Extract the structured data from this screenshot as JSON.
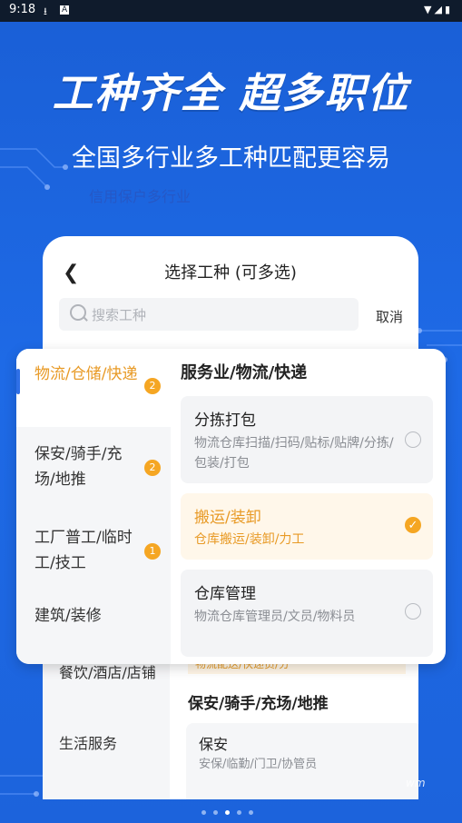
{
  "status": {
    "time": "9:18",
    "icons": [
      "download-icon",
      "app-icon"
    ],
    "right": [
      "wifi-icon",
      "signal-icon",
      "battery-icon"
    ]
  },
  "headline": "工种齐全  超多职位",
  "subline": "全国多行业多工种匹配更容易",
  "faint_text": "信用保户多行业",
  "screen": {
    "title": "选择工种 (可多选)",
    "search_placeholder": "搜索工种",
    "cancel": "取消"
  },
  "categories": [
    {
      "label": "物流/仓储/快递",
      "count": "2",
      "active": true
    },
    {
      "label": "保安/骑手/充场/地推",
      "count": "2",
      "active": false
    },
    {
      "label": "工厂普工/临时工/技工",
      "count": "1",
      "active": false
    },
    {
      "label": "建筑/装修",
      "count": "",
      "active": false
    }
  ],
  "section_title": "服务业/物流/快递",
  "jobs": [
    {
      "name": "分拣打包",
      "desc": "物流仓库扫描/扫码/贴标/贴牌/分拣/包装/打包",
      "selected": false
    },
    {
      "name": "搬运/装卸",
      "desc": "仓库搬运/装卸/力工",
      "selected": true
    },
    {
      "name": "仓库管理",
      "desc": "物流仓库管理员/文员/物料员",
      "selected": false
    }
  ],
  "background_list": {
    "items": [
      "餐饮/酒店/店铺",
      "生活服务"
    ],
    "peek": "物流配送/快递员/分",
    "section": "保安/骑手/充场/地推",
    "card_name": "保安",
    "card_desc": "安保/临勤/门卫/协管员"
  },
  "watermark": "wm",
  "colors": {
    "accent": "#f5a623",
    "brand_blue": "#1e6ae6"
  }
}
